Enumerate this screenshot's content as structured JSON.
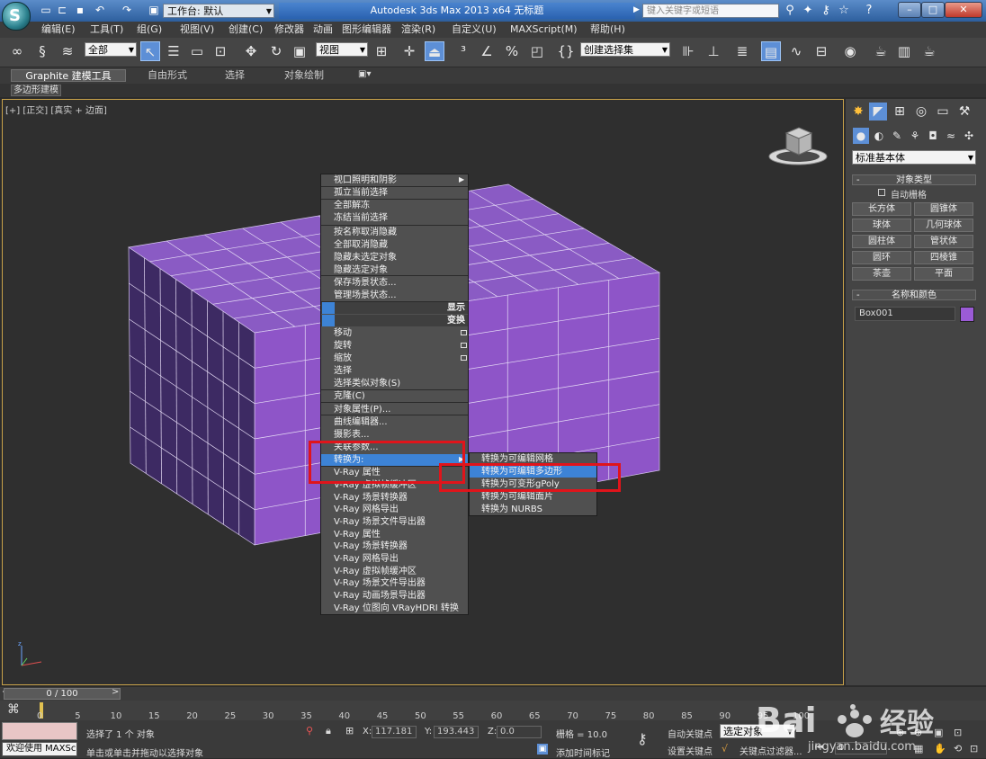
{
  "titlebar": {
    "workspace_label": "工作台: 默认",
    "app_title": "Autodesk 3ds Max  2013 x64      无标题",
    "search_placeholder": "键入关键字或短语"
  },
  "menu": [
    "编辑(E)",
    "工具(T)",
    "组(G)",
    "视图(V)",
    "创建(C)",
    "修改器",
    "动画",
    "图形编辑器",
    "渲染(R)",
    "自定义(U)",
    "MAXScript(M)",
    "帮助(H)"
  ],
  "toolbar": {
    "selection_filter": "全部",
    "ref_coord": "视图",
    "named_selection": "创建选择集"
  },
  "ribbon": {
    "tabs": [
      "Graphite 建模工具",
      "自由形式",
      "选择",
      "对象绘制"
    ],
    "subtab": "多边形建模"
  },
  "viewport": {
    "label": "[+] [正交] [真实 + 边面]",
    "box_top_color": "#8a5bc4",
    "box_front_color": "#8e55c8",
    "box_side_color": "#3d2a63"
  },
  "context_menu": {
    "items": [
      {
        "label": "视口照明和阴影",
        "arrow": true
      },
      {
        "label": "孤立当前选择"
      },
      {
        "label": "全部解冻"
      },
      {
        "label": "冻结当前选择"
      },
      {
        "label": "按名称取消隐藏"
      },
      {
        "label": "全部取消隐藏"
      },
      {
        "label": "隐藏未选定对象"
      },
      {
        "label": "隐藏选定对象"
      },
      {
        "label": "保存场景状态..."
      },
      {
        "label": "管理场景状态..."
      },
      {
        "label": "移动"
      },
      {
        "label": "旋转"
      },
      {
        "label": "缩放"
      },
      {
        "label": "选择"
      },
      {
        "label": "选择类似对象(S)"
      },
      {
        "label": "克隆(C)"
      },
      {
        "label": "对象属性(P)..."
      },
      {
        "label": "曲线编辑器..."
      },
      {
        "label": "摄影表..."
      },
      {
        "label": "关联参数..."
      },
      {
        "label": "转换为:",
        "arrow": true
      },
      {
        "label": "V-Ray 属性"
      },
      {
        "label": "V-Ray 虚拟帧缓冲区"
      },
      {
        "label": "V-Ray 场景转换器"
      },
      {
        "label": "V-Ray 网格导出"
      },
      {
        "label": "V-Ray 场景文件导出器"
      },
      {
        "label": "V-Ray 属性"
      },
      {
        "label": "V-Ray 场景转换器"
      },
      {
        "label": "V-Ray 网格导出"
      },
      {
        "label": "V-Ray 虚拟帧缓冲区"
      },
      {
        "label": "V-Ray 场景文件导出器"
      },
      {
        "label": "V-Ray 动画场景导出器"
      },
      {
        "label": "V-Ray 位图向 VRayHDRI 转换"
      }
    ],
    "quad_display": "显示",
    "quad_transform": "变换",
    "submenu": [
      "转换为可编辑网格",
      "转换为可编辑多边形",
      "转换为可变形gPoly",
      "转换为可编辑面片",
      "转换为 NURBS"
    ]
  },
  "command_panel": {
    "category": "标准基本体",
    "object_type_title": "对象类型",
    "auto_grid": "自动栅格",
    "object_buttons": [
      "长方体",
      "圆锥体",
      "球体",
      "几何球体",
      "圆柱体",
      "管状体",
      "圆环",
      "四棱锥",
      "茶壶",
      "平面"
    ],
    "name_color_title": "名称和颜色",
    "object_name": "Box001",
    "object_color": "#9b5bd6"
  },
  "timeline": {
    "slider": "0 / 100",
    "ticks": [
      "0",
      "5",
      "10",
      "15",
      "20",
      "25",
      "30",
      "35",
      "40",
      "45",
      "50",
      "55",
      "60",
      "65",
      "70",
      "75",
      "80",
      "85",
      "90",
      "95",
      "100"
    ]
  },
  "status": {
    "welcome": "欢迎使用 MAXSc",
    "selected": "选择了 1 个 对象",
    "prompt": "单击或单击并拖动以选择对象",
    "x_label": "X:",
    "x_value": "117.181",
    "y_label": "Y:",
    "y_value": "193.443",
    "z_label": "Z:",
    "z_value": "0.0",
    "grid": "栅格 = 10.0",
    "add_time_tag": "添加时间标记",
    "auto_key": "自动关键点",
    "selected_obj": "选定对象",
    "set_key": "设置关键点",
    "key_filters": "关键点过滤器...",
    "frame": "0"
  },
  "watermark": {
    "brand": "Bai",
    "brand2": "经验",
    "url": "jingyan.baidu.com"
  }
}
